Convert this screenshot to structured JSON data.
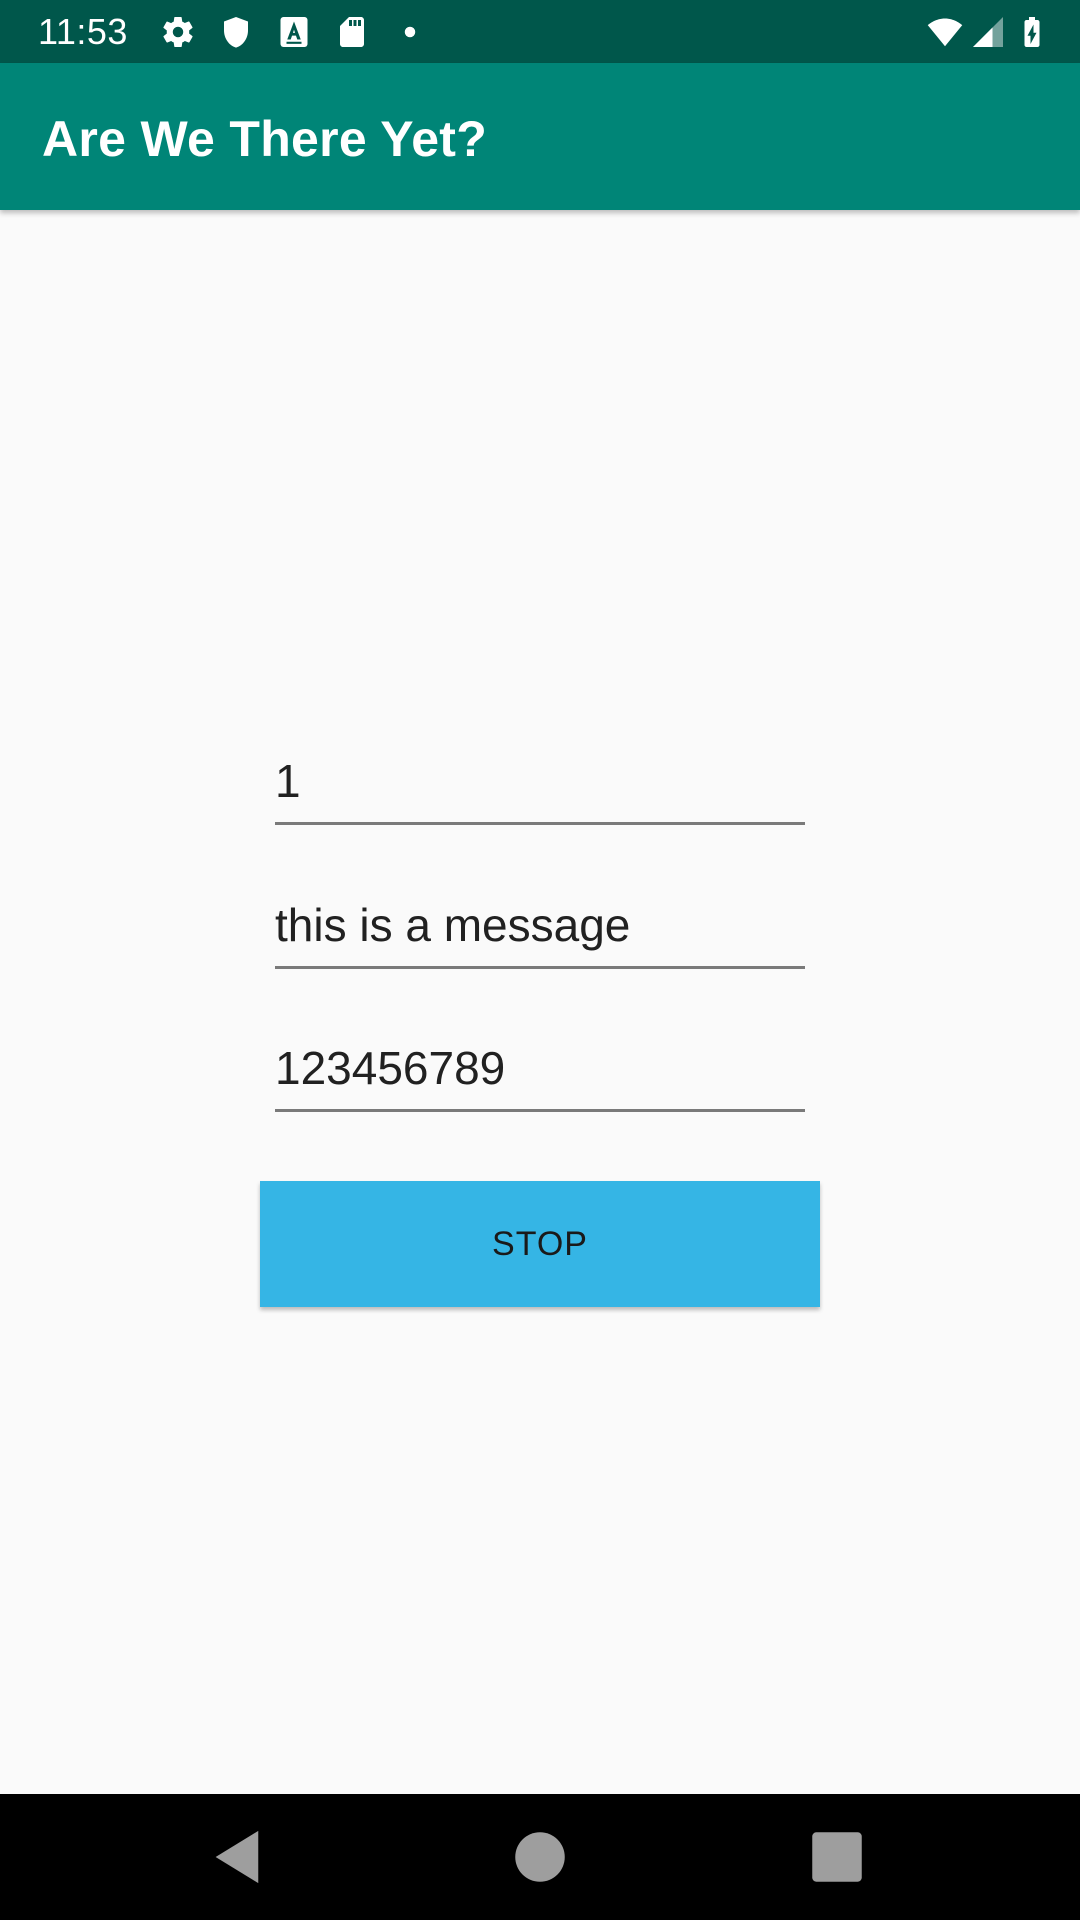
{
  "status_bar": {
    "time": "11:53",
    "icons": [
      "gear-icon",
      "shield-icon",
      "a-accessibility-icon",
      "sd-card-icon",
      "dot-icon",
      "wifi-icon",
      "signal-icon",
      "battery-charging-icon"
    ]
  },
  "app_bar": {
    "title": "Are We There Yet?",
    "color": "#008577",
    "status_color": "#00574b"
  },
  "form": {
    "field1_value": "1",
    "field2_value": "this is a message",
    "field3_value": "123456789"
  },
  "button": {
    "label": "STOP",
    "color": "#35b5e5"
  },
  "nav_bar": {
    "icons": [
      "back-icon",
      "home-icon",
      "recents-icon"
    ]
  }
}
